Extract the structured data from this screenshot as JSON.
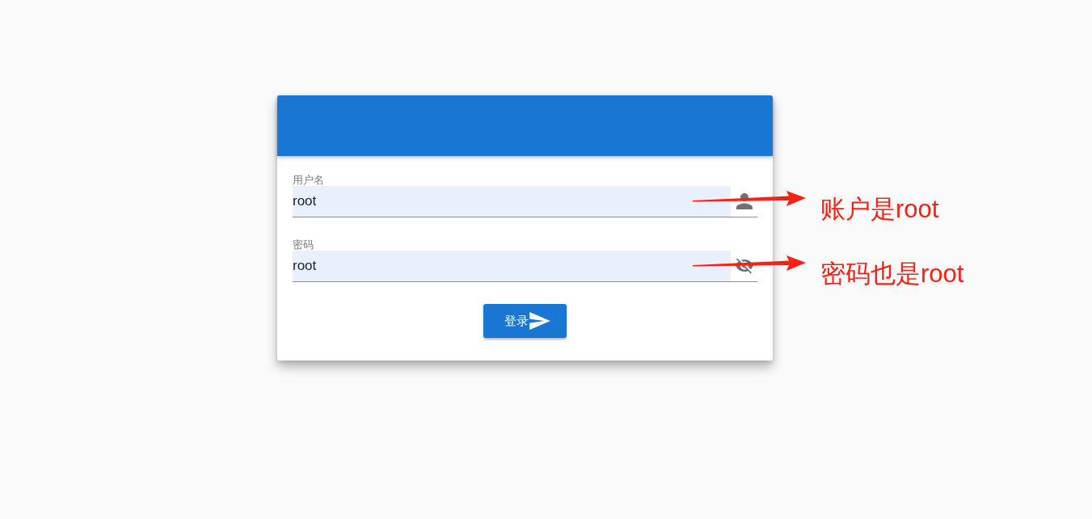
{
  "login_card": {
    "fields": [
      {
        "kind": "username",
        "label": "用户名",
        "value": "root"
      },
      {
        "kind": "password",
        "label": "密码",
        "value": "root"
      }
    ],
    "submit_button": {
      "label": "登录"
    }
  },
  "annotations": [
    {
      "text": "账户是root"
    },
    {
      "text": "密码也是root"
    }
  ]
}
